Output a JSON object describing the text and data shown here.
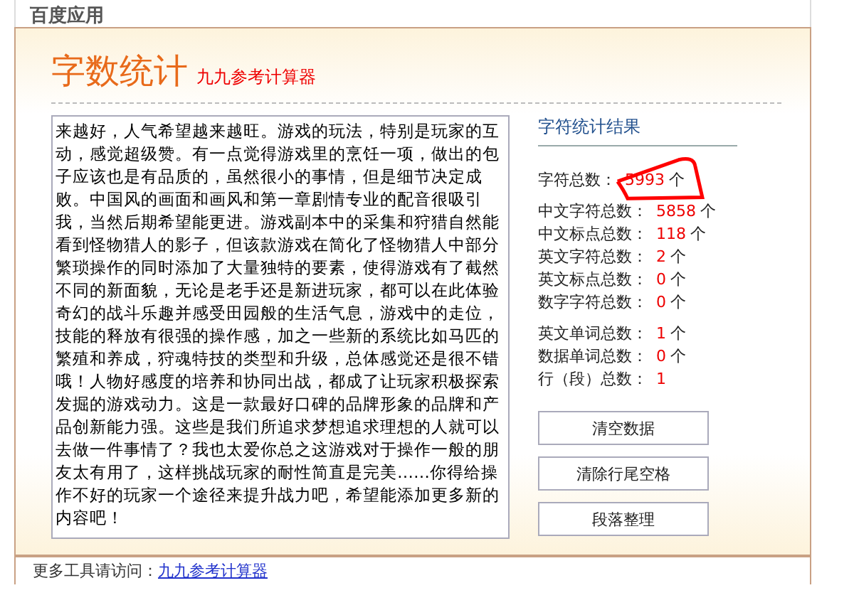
{
  "header": {
    "title": "百度应用"
  },
  "tool": {
    "title": "字数统计",
    "subtitle": "九九参考计算器"
  },
  "editor": {
    "value": "来越好，人气希望越来越旺。游戏的玩法，特别是玩家的互动，感觉超级赞。有一点觉得游戏里的烹饪一项，做出的包子应该也是有品质的，虽然很小的事情，但是细节决定成败。中国风的画面和画风和第一章剧情专业的配音很吸引我，当然后期希望能更进。游戏副本中的采集和狩猎自然能看到怪物猎人的影子，但该款游戏在简化了怪物猎人中部分繁琐操作的同时添加了大量独特的要素，使得游戏有了截然不同的新面貌，无论是老手还是新进玩家，都可以在此体验奇幻的战斗乐趣并感受田园般的生活气息，游戏中的走位，技能的释放有很强的操作感，加之一些新的系统比如马匹的繁殖和养成，狩魂特技的类型和升级，总体感觉还是很不错哦！人物好感度的培养和协同出战，都成了让玩家积极探索发掘的游戏动力。这是一款最好口碑的品牌形象的品牌和产品创新能力强。这些是我们所追求梦想追求理想的人就可以去做一件事情了？我也太爱你总之这游戏对于操作一般的朋友太有用了，这样挑战玩家的耐性简直是完美……你得给操作不好的玩家一个途径来提升战力吧，希望能添加更多新的内容吧！"
  },
  "results": {
    "title": "字符统计结果",
    "groups": [
      [
        {
          "label": "字符总数：",
          "value": "5993",
          "unit": "个"
        }
      ],
      [
        {
          "label": "中文字符总数：",
          "value": "5858",
          "unit": "个"
        },
        {
          "label": "中文标点总数：",
          "value": "118",
          "unit": "个"
        },
        {
          "label": "英文字符总数：",
          "value": "2",
          "unit": "个"
        },
        {
          "label": "英文标点总数：",
          "value": "0",
          "unit": "个"
        },
        {
          "label": "数字字符总数：",
          "value": "0",
          "unit": "个"
        }
      ],
      [
        {
          "label": "英文单词总数：",
          "value": "1",
          "unit": "个"
        },
        {
          "label": "数据单词总数：",
          "value": "0",
          "unit": "个"
        },
        {
          "label": "行（段）总数：",
          "value": "1"
        }
      ]
    ]
  },
  "buttons": [
    "清空数据",
    "清除行尾空格",
    "段落整理"
  ],
  "footer": {
    "text": "更多工具请访问：",
    "link": "九九参考计算器"
  }
}
